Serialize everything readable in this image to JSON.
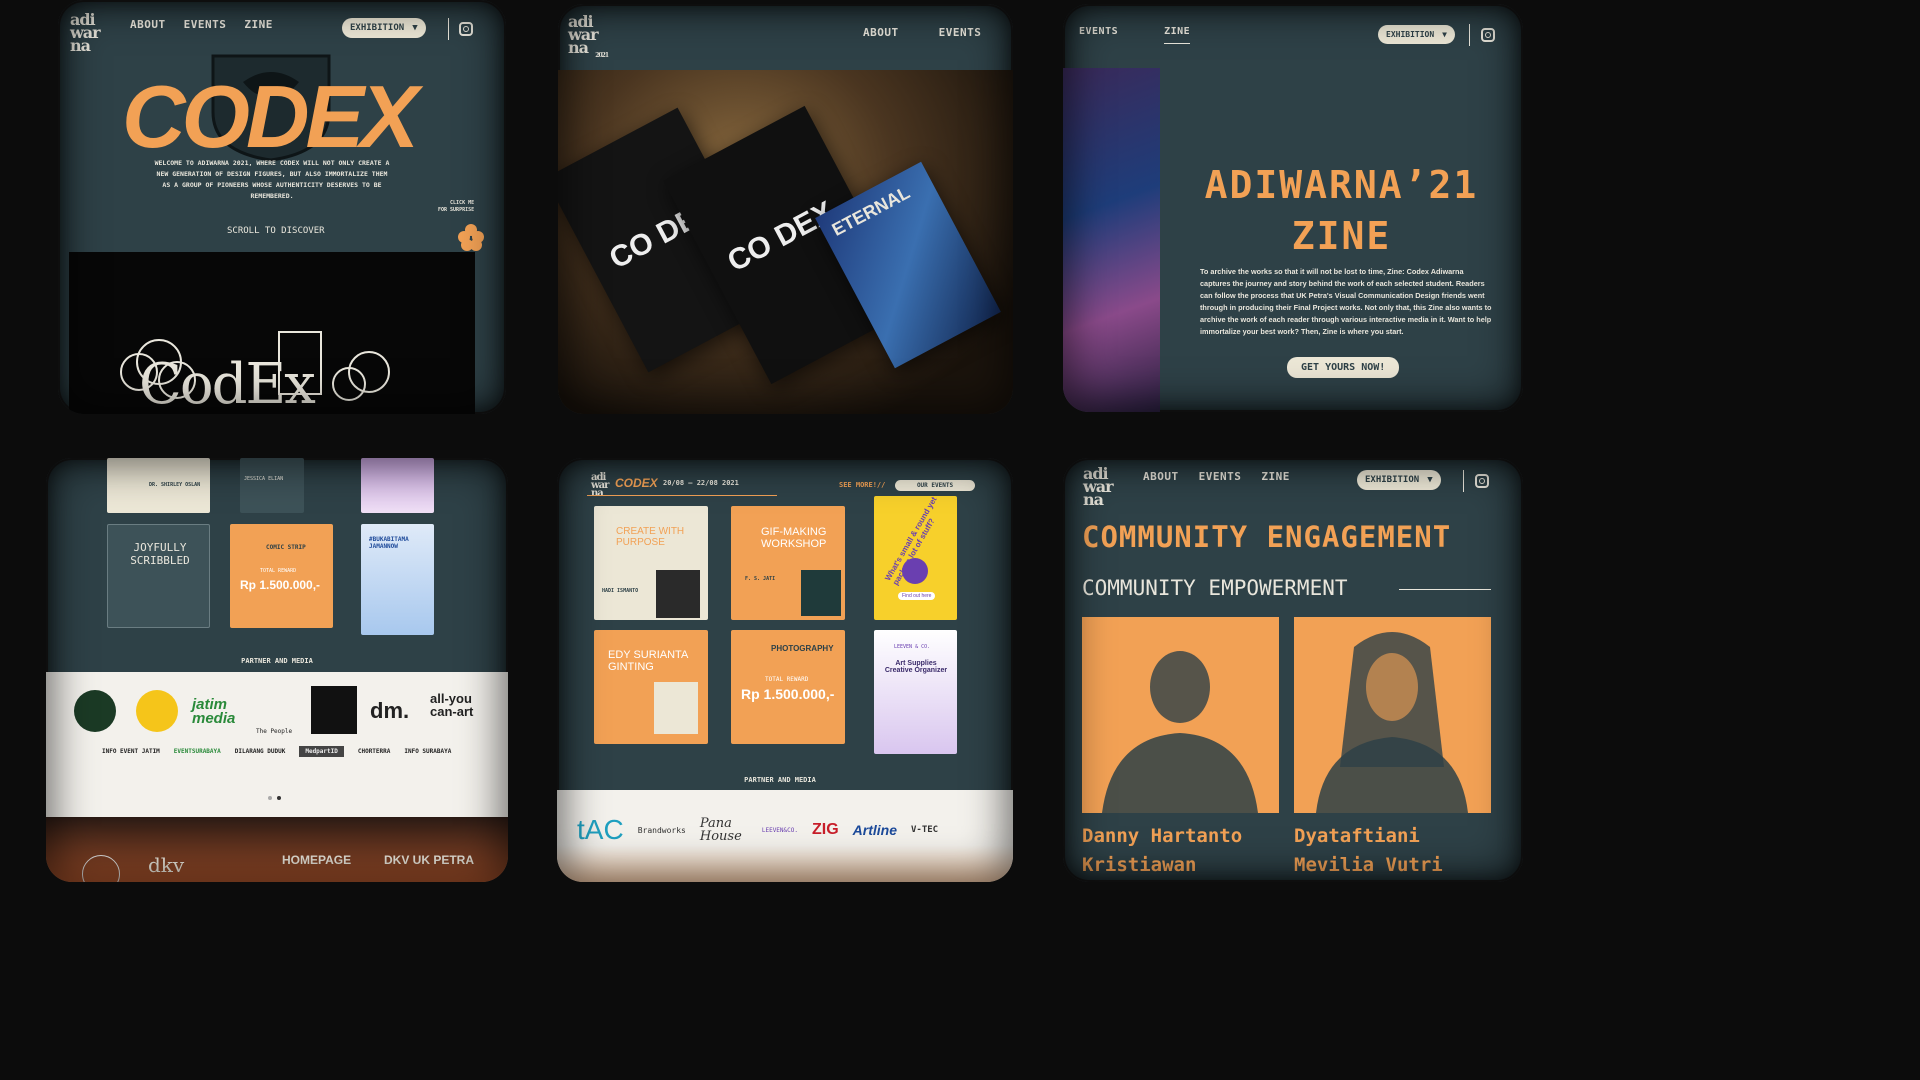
{
  "colors": {
    "teal": "#2e4147",
    "orange": "#f2a155",
    "cream": "#ece7d6"
  },
  "logo_text": "adi war na",
  "logo_year": "2021",
  "p1": {
    "nav": [
      "ABOUT",
      "EVENTS",
      "ZINE"
    ],
    "exhibition": "EXHIBITION",
    "caret": "▼",
    "title": "CODEX",
    "welcome": "WELCOME TO ADIWARNA 2021, WHERE CODEX WILL NOT ONLY CREATE A NEW GENERATION OF DESIGN FIGURES, BUT ALSO IMMORTALIZE THEM AS A GROUP OF PIONEERS WHOSE AUTHENTICITY DESERVES TO BE REMEMBERED.",
    "click_me": "CLICK ME",
    "for_surprise": "FOR SURPRISE",
    "scroll": "SCROLL TO DISCOVER",
    "banner_text": "CodEx"
  },
  "p2": {
    "nav": [
      "ABOUT",
      "EVENTS"
    ],
    "book_text_a": "CO DEX",
    "book_text_b": "CO DEX",
    "book_text_c": "ETERNAL"
  },
  "p3": {
    "nav": [
      "EVENTS",
      "ZINE"
    ],
    "exhibition": "EXHIBITION",
    "title_line1": "ADIWARNA’21",
    "title_line2": "ZINE",
    "body": "To archive the works so that it will not be lost to time, Zine: Codex Adiwarna captures the journey and story behind the work of each selected student. Readers can follow the process that UK Petra's Visual Communication Design friends went through in producing their Final Project works. Not only that, this Zine also wants to archive the work of each reader through various interactive media in it. Want to help immortalize your best work? Then, Zine is where you start.",
    "cta": "GET YOURS NOW!"
  },
  "p4": {
    "posters": [
      {
        "text": "DR. SHIRLEY OSLAN"
      },
      {
        "text": "JESSICA ELIAN"
      },
      {
        "text": ""
      },
      {
        "text": "JOYFULLY SCRIBBLED"
      },
      {
        "text": "COMIC STRIP",
        "reward_label": "TOTAL REWARD",
        "reward": "Rp 1.500.000,-"
      },
      {
        "text": "#BUKABITAMA JAMANNOW"
      }
    ],
    "partner_title": "PARTNER AND MEDIA",
    "partners_row1": [
      "jatim media",
      "The People",
      "dm.",
      "all-you can-art"
    ],
    "partners_row2": [
      "INFO EVENT JATIM",
      "EVENTSURABAYA",
      "DILARANG DUDUK",
      "MedpartID",
      "CHORTERRA",
      "INFO SURABAYA"
    ],
    "footer_links": [
      "HOMEPAGE",
      "DKV UK PETRA"
    ],
    "footer_logo": "dkv"
  },
  "p5": {
    "brand": "CODEX",
    "dates": "20/08 – 22/08 2021",
    "see_more": "SEE MORE!//",
    "our_events": "OUR EVENTS",
    "posters": [
      {
        "title": "CREATE WITH PURPOSE",
        "name": "HADI ISMANTO"
      },
      {
        "title": "GIF-MAKING WORKSHOP",
        "name": "F. S. JATI"
      },
      {
        "title": "What's small & round yet packs a lot of stuff?",
        "name": "Find out here"
      },
      {
        "title": "EDY SURIANTA GINTING",
        "name": ""
      },
      {
        "title": "PHOTOGRAPHY",
        "reward_label": "TOTAL REWARD",
        "reward": "Rp 1.500.000,-"
      },
      {
        "title": "Art Supplies Creative Organizer",
        "name": "LEEVEN & CO."
      }
    ],
    "partner_title": "PARTNER AND MEDIA",
    "partners": [
      "tAC",
      "Brandworks",
      "Pana House",
      "LEEVEN&CO.",
      "ZIG",
      "Artline",
      "V-TEC"
    ]
  },
  "p6": {
    "nav": [
      "ABOUT",
      "EVENTS",
      "ZINE"
    ],
    "exhibition": "EXHIBITION",
    "heading": "COMMUNITY ENGAGEMENT",
    "subheading": "COMMUNITY EMPOWERMENT",
    "people": [
      {
        "first": "Danny Hartanto",
        "last": "Kristiawan"
      },
      {
        "first": "Dyataftiani",
        "last": "Mevilia Vutri"
      }
    ]
  }
}
